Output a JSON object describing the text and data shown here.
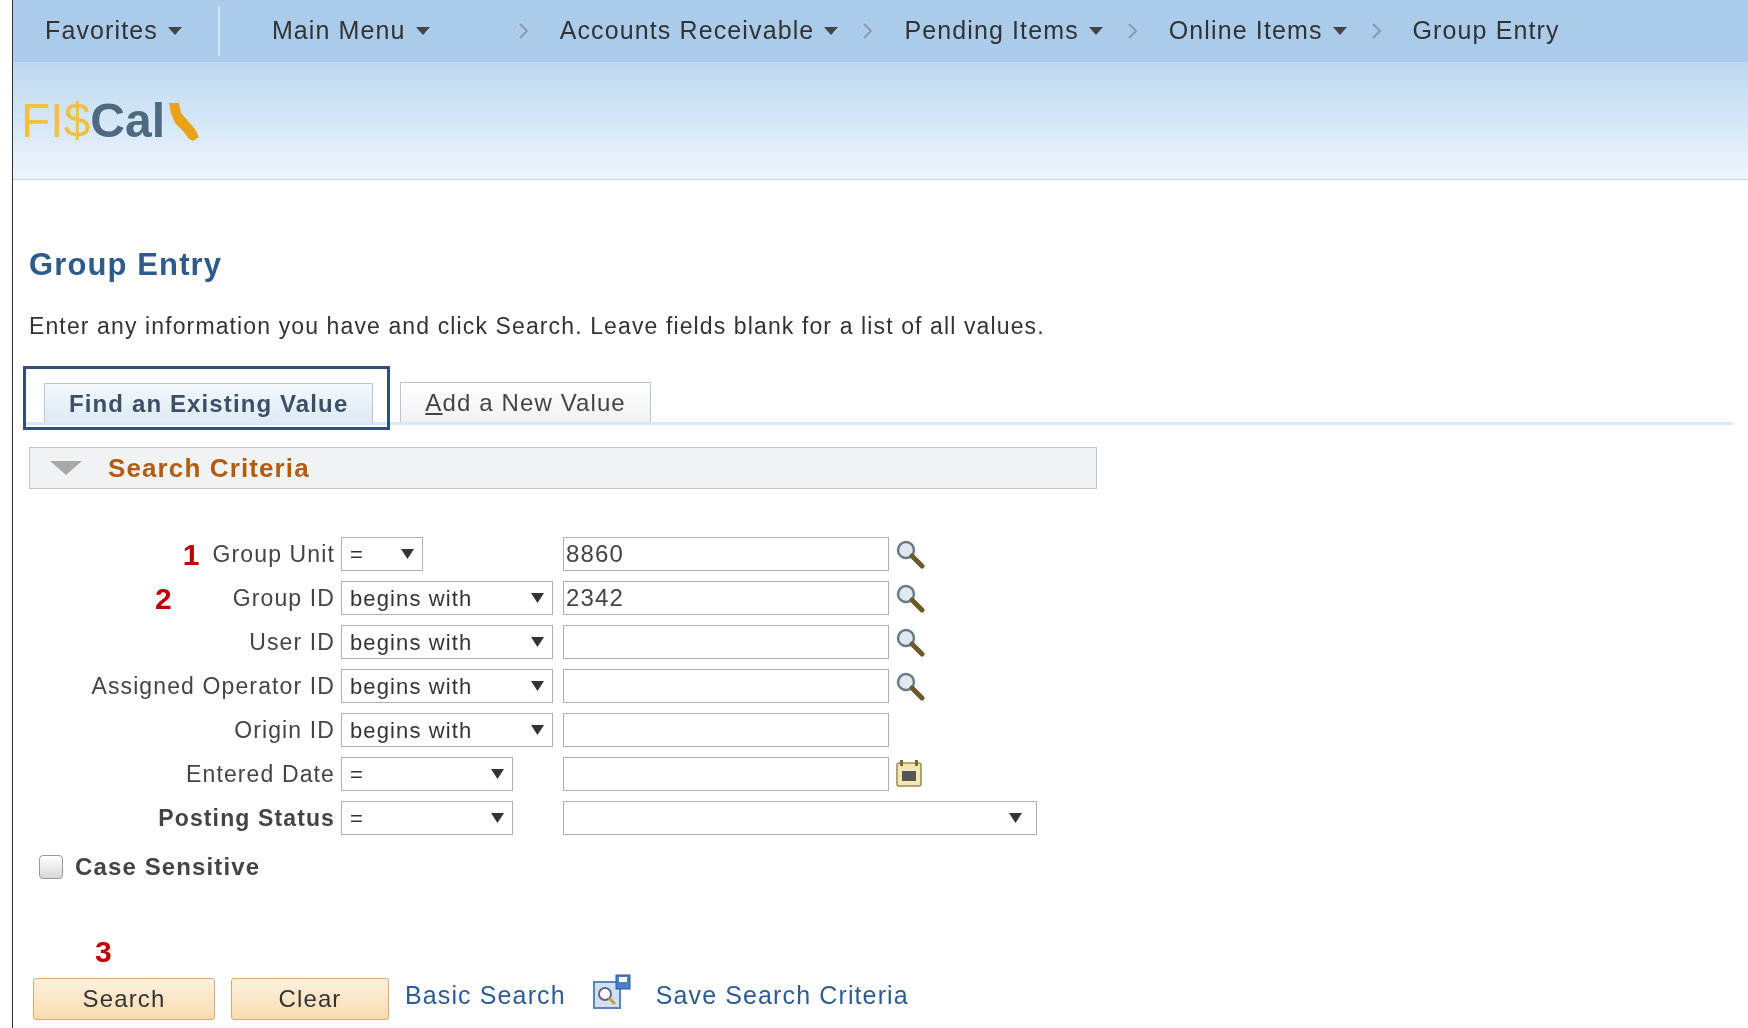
{
  "nav": {
    "items": [
      {
        "label": "Favorites",
        "kind": "menu"
      },
      {
        "label": "Main Menu",
        "kind": "menu"
      },
      {
        "label": "Accounts Receivable",
        "kind": "crumb_menu"
      },
      {
        "label": "Pending Items",
        "kind": "crumb_menu"
      },
      {
        "label": "Online Items",
        "kind": "crumb_menu"
      },
      {
        "label": "Group Entry",
        "kind": "crumb"
      }
    ]
  },
  "logo": {
    "part_1": "FI$",
    "part_2": "Cal"
  },
  "page_title": "Group Entry",
  "instructions": "Enter any information you have and click Search. Leave fields blank for a list of all values.",
  "tabs": [
    {
      "label": "Find an Existing Value",
      "selected": true,
      "highlighted": true,
      "access_key_underlined": false
    },
    {
      "label": "Add a New Value",
      "selected": false,
      "highlighted": false,
      "access_key_underlined": true
    }
  ],
  "section": {
    "title": "Search Criteria",
    "expanded": true
  },
  "fields": [
    {
      "label": "Group Unit",
      "annotation": "1",
      "bold": false,
      "operator": "=",
      "value": "8860",
      "kind": "lookup"
    },
    {
      "label": "Group ID",
      "annotation": "2",
      "bold": false,
      "operator": "begins with",
      "value": "2342",
      "kind": "lookup"
    },
    {
      "label": "User ID",
      "bold": false,
      "operator": "begins with",
      "kind": "lookup"
    },
    {
      "label": "Assigned Operator ID",
      "bold": false,
      "operator": "begins with",
      "kind": "lookup"
    },
    {
      "label": "Origin ID",
      "bold": false,
      "operator": "begins with",
      "kind": "text"
    },
    {
      "label": "Entered Date",
      "bold": false,
      "operator": "=",
      "kind": "date"
    },
    {
      "label": "Posting Status",
      "bold": true,
      "operator": "=",
      "kind": "select"
    }
  ],
  "case_sensitive": {
    "label": "Case Sensitive",
    "checked": false
  },
  "actions": [
    {
      "label": "Search",
      "kind": "button",
      "annotation": "3"
    },
    {
      "label": "Clear",
      "kind": "button"
    },
    {
      "label": "Basic Search",
      "kind": "link"
    },
    {
      "label": "Save Search Criteria",
      "kind": "icon_link"
    }
  ]
}
